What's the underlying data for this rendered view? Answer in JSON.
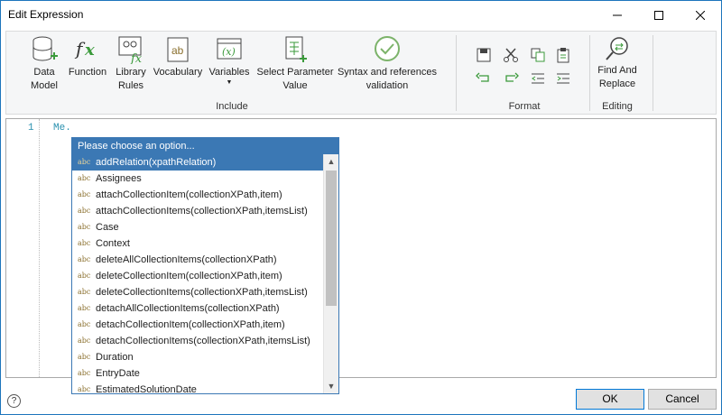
{
  "window": {
    "title": "Edit Expression"
  },
  "ribbon": {
    "items": [
      {
        "label": "Data\nModel"
      },
      {
        "label": "Function"
      },
      {
        "label": "Library\nRules"
      },
      {
        "label": "Vocabulary"
      },
      {
        "label": "Variables"
      },
      {
        "label": "Select Parameter\nValue"
      },
      {
        "label": "Syntax and references\nvalidation"
      },
      {
        "label": "Find And\nReplace"
      }
    ],
    "groups": {
      "include": "Include",
      "format": "Format",
      "editing": "Editing"
    }
  },
  "editor": {
    "line_number": "1",
    "code": "Me."
  },
  "popup": {
    "header": "Please choose an option...",
    "icon_text": "abc",
    "selected_index": 0,
    "items": [
      "addRelation(xpathRelation)",
      "Assignees",
      "attachCollectionItem(collectionXPath,item)",
      "attachCollectionItems(collectionXPath,itemsList)",
      "Case",
      "Context",
      "deleteAllCollectionItems(collectionXPath)",
      "deleteCollectionItem(collectionXPath,item)",
      "deleteCollectionItems(collectionXPath,itemsList)",
      "detachAllCollectionItems(collectionXPath)",
      "detachCollectionItem(collectionXPath,item)",
      "detachCollectionItems(collectionXPath,itemsList)",
      "Duration",
      "EntryDate",
      "EstimatedSolutionDate"
    ]
  },
  "footer": {
    "help": "?",
    "ok": "OK",
    "cancel": "Cancel"
  }
}
